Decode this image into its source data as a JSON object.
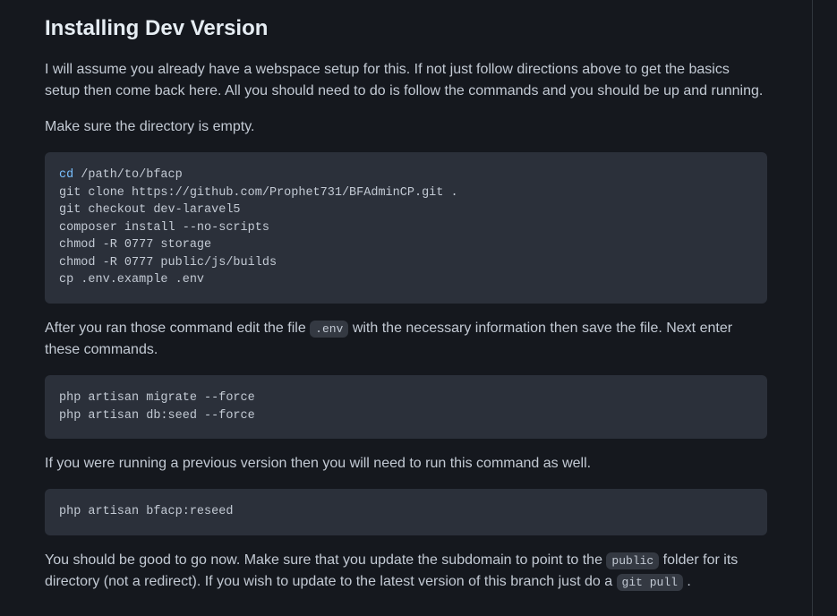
{
  "heading": "Installing Dev Version",
  "para1": "I will assume you already have a webspace setup for this. If not just follow directions above to get the basics setup then come back here. All you should need to do is follow the commands and you should be up and running.",
  "para2": "Make sure the directory is empty.",
  "code1_kw": "cd",
  "code1_rest": " /path/to/bfacp\ngit clone https://github.com/Prophet731/BFAdminCP.git .\ngit checkout dev-laravel5\ncomposer install --no-scripts\nchmod -R 0777 storage\nchmod -R 0777 public/js/builds\ncp .env.example .env",
  "para3a": "After you ran those command edit the file ",
  "inline_env": ".env",
  "para3b": " with the necessary information then save the file. Next enter these commands.",
  "code2": "php artisan migrate --force\nphp artisan db:seed --force",
  "para4": "If you were running a previous version then you will need to run this command as well.",
  "code3": "php artisan bfacp:reseed",
  "para5a": "You should be good to go now. Make sure that you update the subdomain to point to the ",
  "inline_public": "public",
  "para5b": " folder for its directory (not a redirect). If you wish to update to the latest version of this branch just do a ",
  "inline_gitpull": "git pull",
  "para5c": " ."
}
